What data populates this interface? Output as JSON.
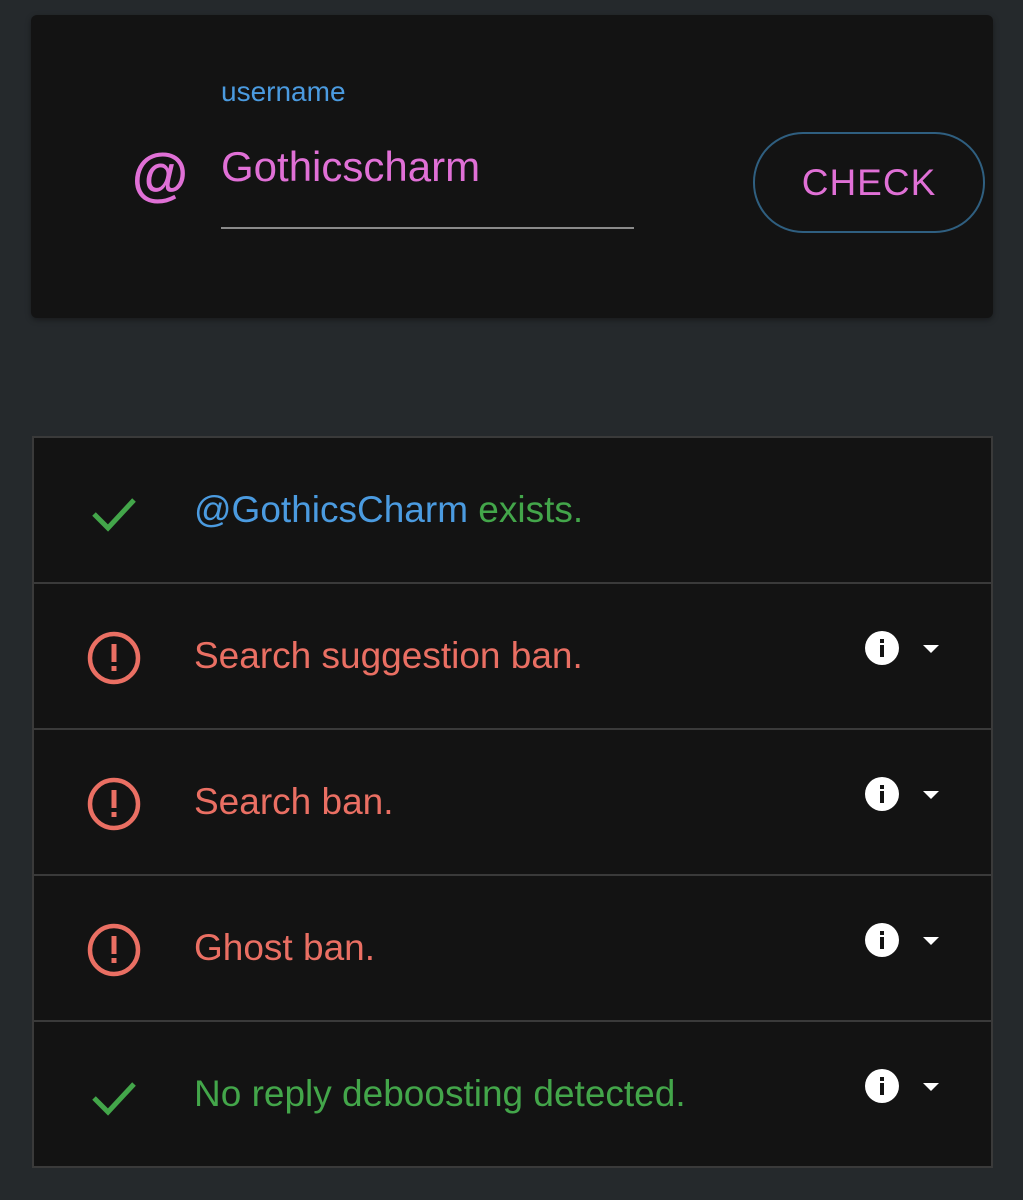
{
  "search": {
    "label": "username",
    "value": "Gothicscharm",
    "at_symbol": "@",
    "check_button": "CHECK"
  },
  "colors": {
    "accent_pink": "#e070d6",
    "accent_blue": "#4b9be0",
    "success_green": "#43a64a",
    "error_red": "#ea6f63"
  },
  "results": [
    {
      "status": "ok",
      "icon": "checkmark-icon",
      "handle": "@GothicsCharm",
      "text": " exists.",
      "has_details": false
    },
    {
      "status": "bad",
      "icon": "alert-circle-icon",
      "text": "Search suggestion ban.",
      "has_details": true
    },
    {
      "status": "bad",
      "icon": "alert-circle-icon",
      "text": "Search ban.",
      "has_details": true
    },
    {
      "status": "bad",
      "icon": "alert-circle-icon",
      "text": "Ghost ban.",
      "has_details": true
    },
    {
      "status": "ok",
      "icon": "checkmark-icon",
      "text": "No reply deboosting detected.",
      "has_details": true
    }
  ]
}
